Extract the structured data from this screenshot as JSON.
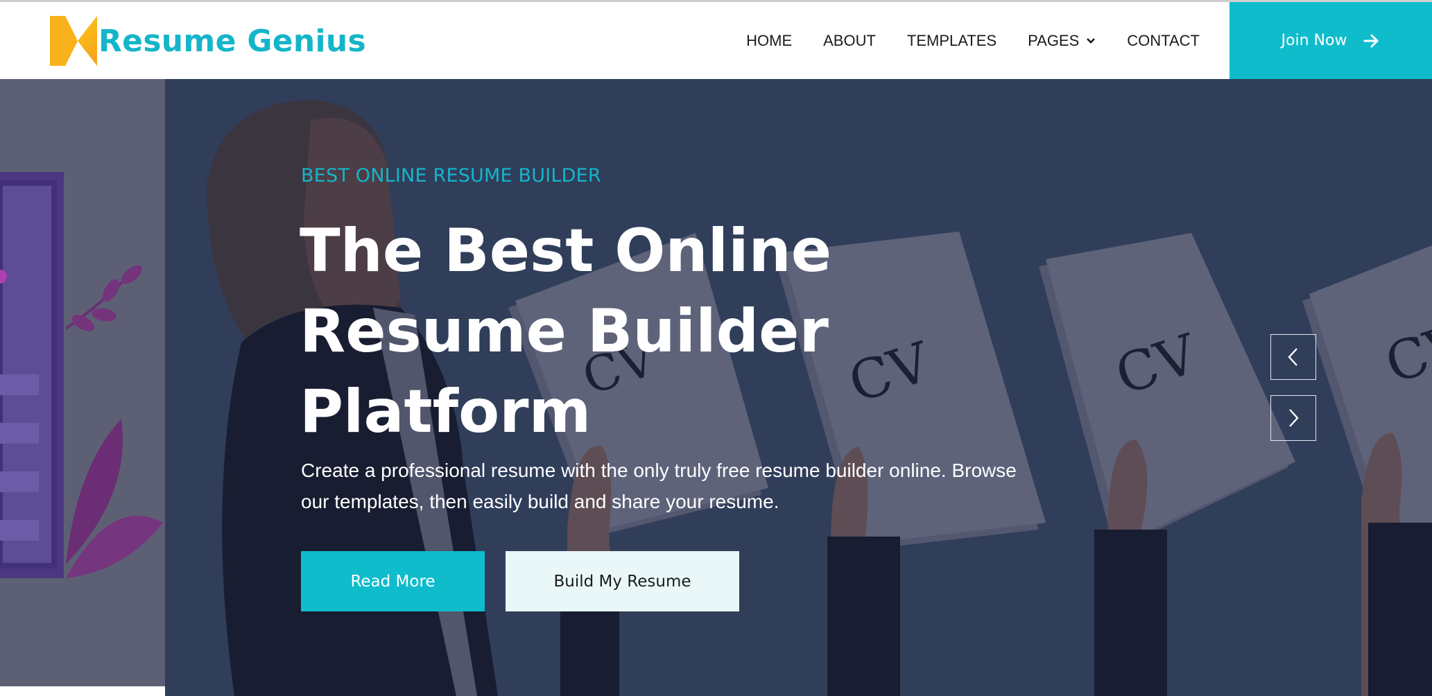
{
  "brand": {
    "name": "Resume Genius",
    "color": "#15b5c9",
    "logo_icon": "logo-mark-icon"
  },
  "nav": {
    "items": [
      {
        "label": "HOME"
      },
      {
        "label": "ABOUT"
      },
      {
        "label": "TEMPLATES"
      },
      {
        "label": "PAGES",
        "has_dropdown": true
      },
      {
        "label": "CONTACT"
      }
    ],
    "cta_label": "Join Now",
    "cta_icon": "arrow-right-icon",
    "cta_color": "#0fbccc"
  },
  "hero": {
    "eyebrow": "BEST ONLINE RESUME BUILDER",
    "headline_lines": [
      "The Best Online",
      "Resume Builder",
      "Platform"
    ],
    "description_lines": [
      "Create a professional resume with the only truly free resume builder online. Browse",
      "our templates, then easily build and share your resume."
    ],
    "primary_button": "Read More",
    "secondary_button": "Build My Resume",
    "background_color": "#34435f",
    "cv_label": "CV",
    "prev_icon": "chevron-left-icon",
    "next_icon": "chevron-right-icon"
  }
}
